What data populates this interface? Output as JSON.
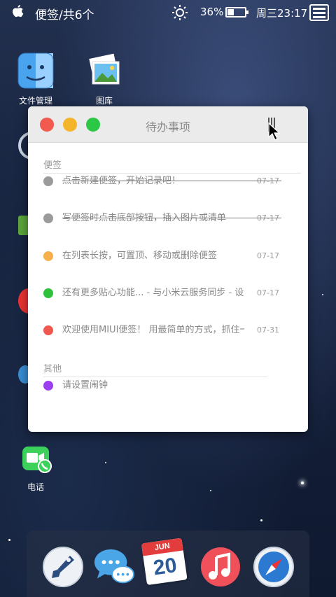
{
  "status_bar": {
    "app_title": "便签/共6个",
    "battery_percent": "36%",
    "battery_level": 0.36,
    "time": "周三23:17"
  },
  "desktop": {
    "icons": [
      {
        "name": "file-manager",
        "label": "文件管理"
      },
      {
        "name": "gallery",
        "label": "图库"
      },
      {
        "name": "phone",
        "label": "电话"
      }
    ]
  },
  "window": {
    "title": "待办事项",
    "sections": [
      {
        "header": "便签",
        "notes": [
          {
            "text": "点击新建便签，开始记录吧！",
            "date": "07-17",
            "color": "#9b9b9b",
            "done": true
          },
          {
            "text": "写便签时点击底部按钮，插入图片或清单",
            "date": "07-17",
            "color": "#9b9b9b",
            "done": true
          },
          {
            "text": "在列表长按，可置顶、移动或删除便签",
            "date": "07-17",
            "color": "#f5b04c",
            "done": false
          },
          {
            "text": "还有更多贴心功能... - 与小米云服务同步 - 设置",
            "date": "07-17",
            "color": "#2fc13c",
            "done": false
          },
          {
            "text": "欢迎使用MIUI便签！ 用最简单的方式，抓住一",
            "date": "07-31",
            "color": "#f0584f",
            "done": false
          }
        ]
      },
      {
        "header": "其他",
        "notes": [
          {
            "text": "请设置闹钟",
            "date": "",
            "color": "#9b3ff0",
            "done": false
          }
        ]
      }
    ]
  },
  "dock": {
    "calendar_month": "JUN",
    "calendar_day": "20"
  }
}
